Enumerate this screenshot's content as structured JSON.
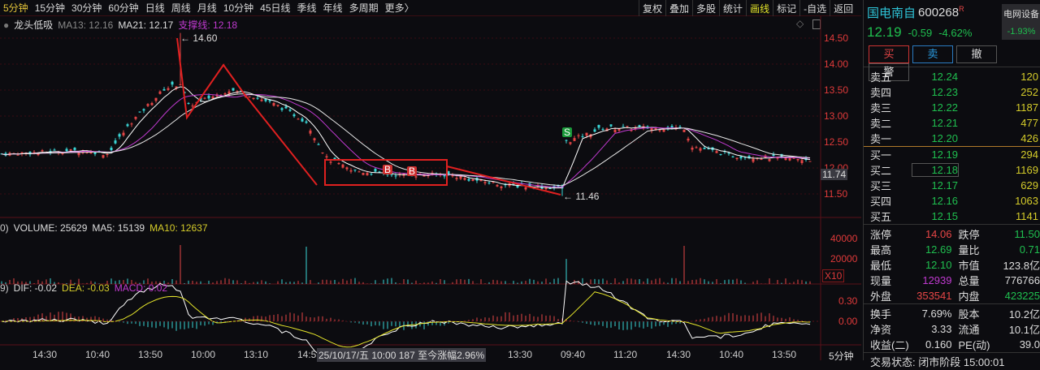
{
  "periods": [
    "5分钟",
    "15分钟",
    "30分钟",
    "60分钟",
    "日线",
    "周线",
    "月线",
    "10分钟",
    "45日线",
    "季线",
    "年线",
    "多周期",
    "更多〉"
  ],
  "active_period": "5分钟",
  "tools": [
    "复权",
    "叠加",
    "多股",
    "统计",
    "画线",
    "标记",
    "-自选",
    "返回"
  ],
  "legend": {
    "name": "龙头低吸",
    "ma13": "MA13: 12.16",
    "ma21": "MA21: 12.17",
    "support": "支撑线: 12.18"
  },
  "price_axis": [
    "14.50",
    "14.00",
    "13.50",
    "13.00",
    "12.50",
    "12.00",
    "11.50"
  ],
  "last_price_tag": "11.74",
  "high_label": "14.60",
  "low_label": "11.46",
  "signals": [
    "S",
    "B",
    "B"
  ],
  "volume": {
    "prefix": "0)",
    "label": "VOLUME: 25629",
    "ma5": "MA5: 15139",
    "ma10": "MA10: 12637",
    "axis": [
      "40000",
      "20000"
    ],
    "unit": "X10"
  },
  "macd": {
    "prefix": "9)",
    "dif": "DIF: -0.02",
    "dea": "DEA: -0.03",
    "macd": "MACD: 0.02",
    "axis": [
      "0.30",
      "0.00"
    ]
  },
  "time_axis": [
    "14:30",
    "10:40",
    "13:50",
    "10:00",
    "13:10",
    "14:5",
    "13:30",
    "09:40",
    "11:20",
    "14:30",
    "10:40",
    "13:50"
  ],
  "cursor_info": "25/10/17/五 10:00 187 至今涨幅2.96%",
  "period_label": "5分钟",
  "chart_data": {
    "type": "candlestick",
    "series_keypoints": [
      [
        0,
        12.27
      ],
      [
        20,
        12.34
      ],
      [
        26,
        12.27
      ],
      [
        32,
        12.89
      ],
      [
        40,
        13.52
      ],
      [
        44,
        13.63
      ],
      [
        46,
        13.2
      ],
      [
        56,
        13.5
      ],
      [
        60,
        13.44
      ],
      [
        68,
        13.2
      ],
      [
        75,
        12.89
      ],
      [
        80,
        12.19
      ],
      [
        86,
        11.95
      ],
      [
        96,
        11.87
      ],
      [
        110,
        11.87
      ],
      [
        116,
        11.77
      ],
      [
        124,
        11.67
      ],
      [
        138,
        11.61
      ],
      [
        139,
        12.5
      ],
      [
        148,
        12.77
      ],
      [
        168,
        12.77
      ],
      [
        170,
        12.42
      ],
      [
        180,
        12.23
      ],
      [
        200,
        12.16
      ]
    ],
    "high": 14.6,
    "low": 11.46,
    "ylim": [
      11.3,
      14.7
    ]
  },
  "stock": {
    "name": "国电南自",
    "code": "600268",
    "flag": "R",
    "sector": "电网设备",
    "sector_change": "-1.93%",
    "price": "12.19",
    "change": "-0.59",
    "pct": "-4.62%"
  },
  "buttons": [
    "买",
    "卖",
    "撤",
    "警"
  ],
  "asks": [
    {
      "l": "卖五",
      "p": "12.24",
      "v": "120"
    },
    {
      "l": "卖四",
      "p": "12.23",
      "v": "252"
    },
    {
      "l": "卖三",
      "p": "12.22",
      "v": "1187"
    },
    {
      "l": "卖二",
      "p": "12.21",
      "v": "477"
    },
    {
      "l": "卖一",
      "p": "12.20",
      "v": "426"
    }
  ],
  "bids": [
    {
      "l": "买一",
      "p": "12.19",
      "v": "294"
    },
    {
      "l": "买二",
      "p": "12.18",
      "v": "1169"
    },
    {
      "l": "买三",
      "p": "12.17",
      "v": "629"
    },
    {
      "l": "买四",
      "p": "12.16",
      "v": "1063"
    },
    {
      "l": "买五",
      "p": "12.15",
      "v": "1141"
    }
  ],
  "stats": [
    [
      "涨停",
      "14.06",
      "跌停",
      "11.50"
    ],
    [
      "最高",
      "12.69",
      "量比",
      "0.71"
    ],
    [
      "最低",
      "12.10",
      "市值",
      "123.8亿"
    ],
    [
      "现量",
      "12939",
      "总量",
      "776766"
    ],
    [
      "外盘",
      "353541",
      "内盘",
      "423225"
    ]
  ],
  "stats2": [
    [
      "换手",
      "7.69%",
      "股本",
      "10.2亿"
    ],
    [
      "净资",
      "3.33",
      "流通",
      "10.1亿"
    ],
    [
      "收益(二)",
      "0.160",
      "PE(动)",
      "39.0"
    ]
  ],
  "status": "交易状态: 闭市阶段 15:00:01"
}
